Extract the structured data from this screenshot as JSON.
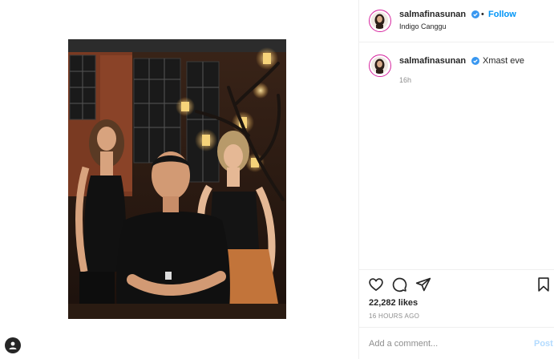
{
  "post": {
    "username": "salmafinasunan",
    "follow_label": "Follow",
    "separator": "•",
    "location": "Indigo Canggu",
    "caption": "Xmast eve",
    "caption_age": "16h",
    "likes": "22,282 likes",
    "timestamp": "16 HOURS AGO",
    "verified": true
  },
  "comment": {
    "placeholder": "Add a comment...",
    "post_label": "Post"
  },
  "icons": {
    "like": "heart-icon",
    "comment": "comment-icon",
    "share": "share-icon",
    "save": "bookmark-icon",
    "verified": "verified-badge-icon",
    "profile": "profile-icon"
  },
  "colors": {
    "link_blue": "#0095f6",
    "post_disabled": "#b3dbff",
    "muted": "#8e8e8e",
    "divider": "#efefef"
  }
}
